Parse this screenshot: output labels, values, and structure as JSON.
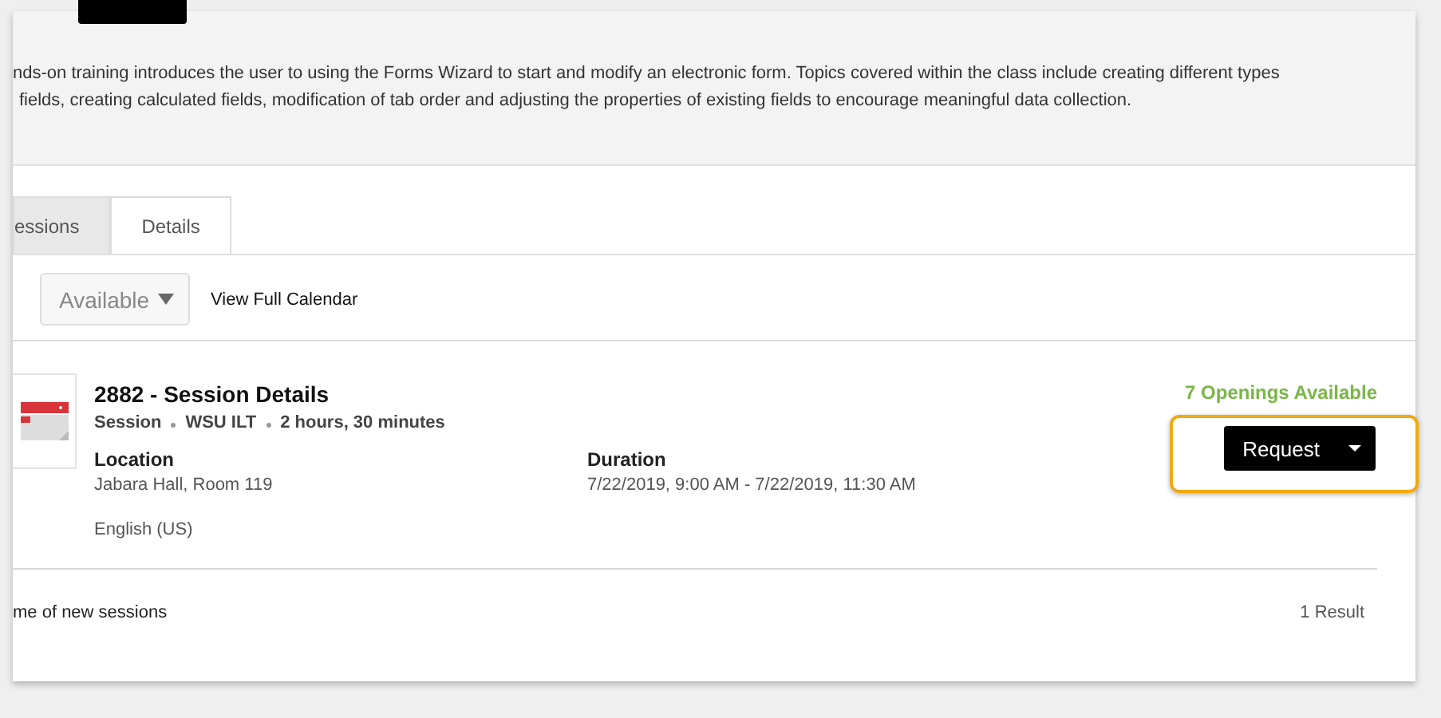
{
  "header": {
    "redacted": true,
    "description_lines": [
      "nds-on training introduces the user to using the Forms Wizard to start and modify an electronic form. Topics covered within the class include creating different types",
      "fields, creating calculated fields, modification of tab order and adjusting the properties of existing fields to encourage meaningful data collection."
    ]
  },
  "tabs": [
    {
      "label": "essions",
      "selected": true
    },
    {
      "label": "Details",
      "selected": false
    }
  ],
  "filter": {
    "value": "Available",
    "link": "View Full Calendar"
  },
  "sessions": [
    {
      "title": "2882 - Session Details",
      "meta": [
        "Session",
        "WSU ILT",
        "2 hours, 30 minutes"
      ],
      "location_label": "Location",
      "location": "Jabara Hall, Room 119",
      "duration_label": "Duration",
      "duration": "7/22/2019, 9:00 AM - 7/22/2019, 11:30 AM",
      "language": "English (US)",
      "openings": "7 Openings Available",
      "button": {
        "label": "Request",
        "highlighted": true
      }
    }
  ],
  "footer": {
    "left": "me of new sessions",
    "right": "1 Result"
  }
}
